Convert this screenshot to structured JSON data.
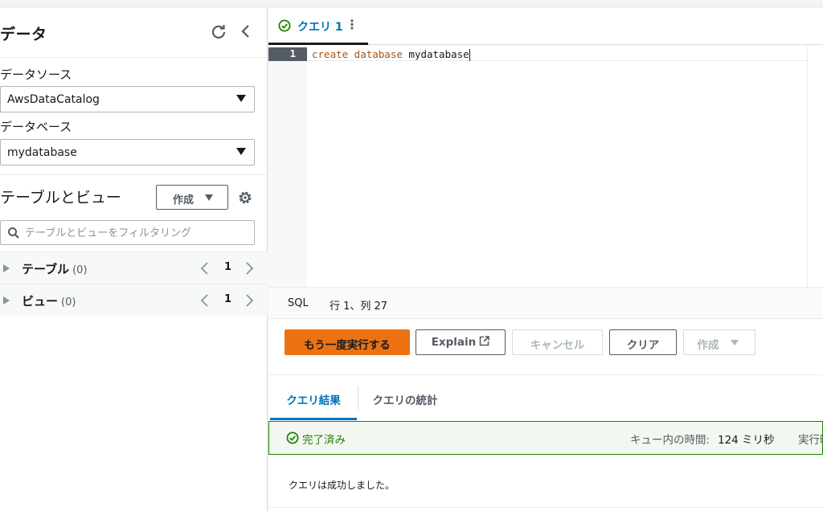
{
  "sidebar": {
    "title": "データ",
    "data_source_label": "データソース",
    "data_source_value": "AwsDataCatalog",
    "database_label": "データベース",
    "database_value": "mydatabase",
    "tables_views_title": "テーブルとビュー",
    "create_button": "作成",
    "filter_placeholder": "テーブルとビューをフィルタリング",
    "tree": [
      {
        "name": "テーブル",
        "count": "(0)",
        "page": "1"
      },
      {
        "name": "ビュー",
        "count": "(0)",
        "page": "1"
      }
    ]
  },
  "editor": {
    "tab_label": "クエリ 1",
    "line_number": "1",
    "code_keywords": "create database",
    "code_identifier": "mydatabase",
    "language": "SQL",
    "cursor_position": "行 1、列 27"
  },
  "actions": {
    "run_again": "もう一度実行する",
    "explain": "Explain",
    "cancel": "キャンセル",
    "clear": "クリア",
    "create": "作成"
  },
  "results": {
    "tab_results": "クエリ結果",
    "tab_stats": "クエリの統計",
    "status": "完了済み",
    "queue_time_label": "キュー内の時間:",
    "queue_time_value": "124 ミリ秒",
    "exec_time_label": "実行時",
    "message": "クエリは成功しました。"
  },
  "colors": {
    "accent_orange": "#ec7211",
    "link_blue": "#0073bb",
    "success_green": "#1d8102"
  },
  "icons": [
    "refresh-icon",
    "collapse-chevron-icon",
    "settings-gear-icon",
    "search-icon",
    "check-circle-icon",
    "more-dots-icon",
    "external-link-icon"
  ]
}
